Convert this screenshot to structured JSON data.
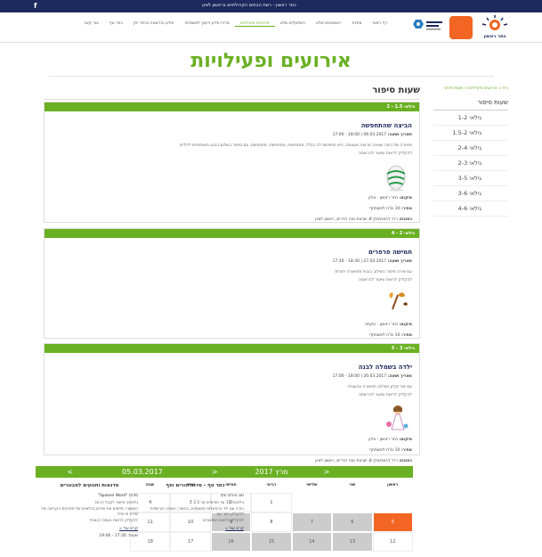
{
  "topbar": {
    "facebook": "f",
    "tagline": "כתר ראשון - רשת הבתים הקהילתיים בראשון לציון"
  },
  "header": {
    "logo_caption": "כתר ראשון"
  },
  "nav": [
    "דף ראשי",
    "אודות",
    "ראשפטים שלנו",
    "המפעלים שלנו",
    "אירועים ופעילויות",
    "מרכז מידע וייעוץ למשפחה",
    "מידע והרשמה בכתר יוק",
    "כתר טף",
    "צור קשר"
  ],
  "nav_active_index": 4,
  "page_title": "אירועים ופעילויות",
  "breadcrumb": "בית » אירועים ופעילויות » שעות סיפור",
  "sidebar": {
    "title": "שעות סיפור",
    "items": [
      "גילאי 1-2",
      "גילאי 1.5-2",
      "גילאי 2-4",
      "גילאי 2-3",
      "גילאי 3-5",
      "גילאי 3-6",
      "גילאי 4-6"
    ]
  },
  "main_title": "שעות סיפור",
  "events": [
    {
      "age": "גילאי 1.5 - 2",
      "title": "הביצה שהתחפשה",
      "date_label": "תאריך ושעה:",
      "date": "06.03.2017 | 18:00 - 17:00",
      "desc": "סיפורה של ביצה שאינה מרוצה מעצמה, היא מחפשת לה בגלל, מתחפשת, מתחפשת, מתחפשת, עם סיפור בשלום בגבע משתתפים לילדים",
      "link": "להקליק לראות שיעור להרשמה",
      "loc_label": "מיקום:",
      "loc": "כתר ראשון - אלון",
      "price_label": "מחיר:",
      "price": "10 ש\"ח למשתתף",
      "addr_label": "כתובת:",
      "addr": "רח' ז'בוטינסקי 8, שכונת נווה הדרים, ראשון לציון"
    },
    {
      "age": "גילאי 2 - 4",
      "title": "חמישה פרפרים",
      "date_label": "תאריך ושעה:",
      "date": "27.03.2017 | 18:30 - 17:30",
      "desc": "עם שירה סיפור בשילוב בובות ותפאורה יחודית",
      "link": "להקליק לראות שיעור להרשמה",
      "loc_label": "מיקום:",
      "loc": "כתר ראשון - נוקמה",
      "price_label": "מחיר:",
      "price": "10 ש\"ח למשתתף",
      "addr_label": "כתובת:",
      "addr": "רח' חיים בר-לב 9, נאות שקמה, ראשון לציון"
    },
    {
      "age": "גילאי 3 - 5",
      "title": "ילדה בשמלה לבנה",
      "date_label": "תאריך ושעה:",
      "date": "20.03.2017 | 18:00 - 17:00",
      "desc": "עם שני וקלון בשילוב תפאורה צבעונית",
      "link": "להקליק לראות שיעור להרשמה",
      "loc_label": "מיקום:",
      "loc": "כתר ראשון - אלון",
      "price_label": "מחיר:",
      "price": "10 ש\"ח למשתתף",
      "addr_label": "כתובת:",
      "addr": "רח' ז'בוטינסקי 8, שכונת נווה הדרים, ראשון לציון"
    }
  ],
  "calendar": {
    "prev": "<",
    "month": "מרץ 2017",
    "next": ">",
    "days": [
      "ראשון",
      "שני",
      "שלישי",
      "רביעי",
      "חמישי",
      "שישי",
      "שבת"
    ],
    "rows": [
      [
        {
          "t": "",
          "c": "e"
        },
        {
          "t": "",
          "c": "e"
        },
        {
          "t": "",
          "c": "e"
        },
        {
          "t": "1",
          "c": "w"
        },
        {
          "t": "2",
          "c": "w"
        },
        {
          "t": "3",
          "c": "w"
        },
        {
          "t": "4",
          "c": "w"
        }
      ],
      [
        {
          "t": "5",
          "c": "o"
        },
        {
          "t": "6",
          "c": "g"
        },
        {
          "t": "7",
          "c": "g"
        },
        {
          "t": "8",
          "c": "w"
        },
        {
          "t": "9",
          "c": "g"
        },
        {
          "t": "10",
          "c": "w"
        },
        {
          "t": "11",
          "c": "w"
        }
      ],
      [
        {
          "t": "12",
          "c": "w"
        },
        {
          "t": "13",
          "c": "g"
        },
        {
          "t": "14",
          "c": "g"
        },
        {
          "t": "15",
          "c": "g"
        },
        {
          "t": "16",
          "c": "g"
        },
        {
          "t": "17",
          "c": "w"
        },
        {
          "t": "18",
          "c": "w"
        }
      ]
    ]
  },
  "news": {
    "prev": "<",
    "date": "05.03.2017",
    "next": ">",
    "cols": [
      {
        "title": "כתר טף - סדנת הורים ופף",
        "sub": "חוג הורים ופף",
        "lines": [
          "גילאים: 10 עד חודשיים עד 2.5",
          "הורה עם ילד בהפעלות תנועתיות, בהשיר, השפה הורשתית",
          "להקליק כתר טף",
          "להקליק לראות השיעורים"
        ],
        "more": "קרא עוד »",
        "time": ""
      },
      {
        "title": "סדנאות ותנועים למבוגרים",
        "sub": "סדנת \"Spoken Word\"",
        "lines": [
          "גילאים: מיועד לקהל הרחב",
          "המשורר מלאים את שירים בכלאיים של תחרויות הקריאה של שירת פרופיל",
          "להקליק לראות בעמוד הנוכחי"
        ],
        "more": "קרא עוד »",
        "time": "שעות: 17:30 - 19:00"
      }
    ]
  }
}
